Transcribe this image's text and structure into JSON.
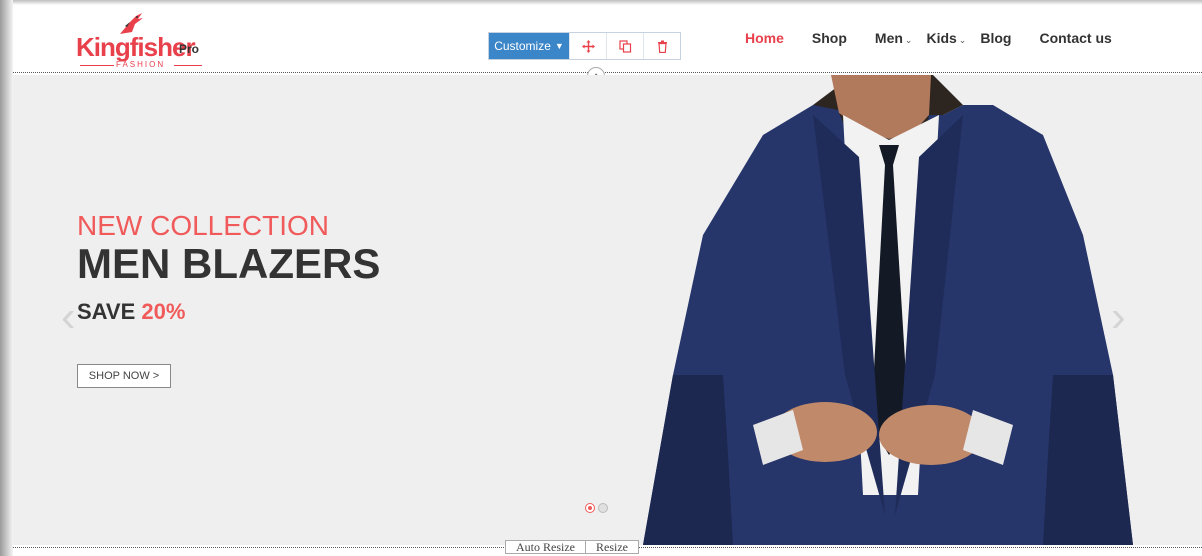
{
  "brand": {
    "name": "Kingfisher",
    "suffix": "Pro",
    "tagline": "FASHION",
    "color": "#e8414c"
  },
  "toolbar": {
    "customize_label": "Customize",
    "buttons": [
      {
        "icon": "move-icon"
      },
      {
        "icon": "copy-icon"
      },
      {
        "icon": "trash-icon"
      }
    ],
    "accent": "#3a86c8"
  },
  "nav": {
    "items": [
      {
        "label": "Home",
        "active": true
      },
      {
        "label": "Shop",
        "active": false
      },
      {
        "label": "Men",
        "dropdown": true
      },
      {
        "label": "Kids",
        "dropdown": true
      },
      {
        "label": "Blog",
        "active": false
      },
      {
        "label": "Contact us",
        "active": false
      }
    ]
  },
  "slide": {
    "subtitle": "NEW COLLECTION",
    "title": "MEN BLAZERS",
    "save_prefix": "SAVE",
    "save_value": "20%",
    "cta_label": "SHOP NOW  >",
    "accent": "#f05a5a",
    "pagination": {
      "total": 2,
      "active": 1
    }
  },
  "editor": {
    "auto_resize_label": "Auto Resize",
    "resize_label": "Resize"
  }
}
